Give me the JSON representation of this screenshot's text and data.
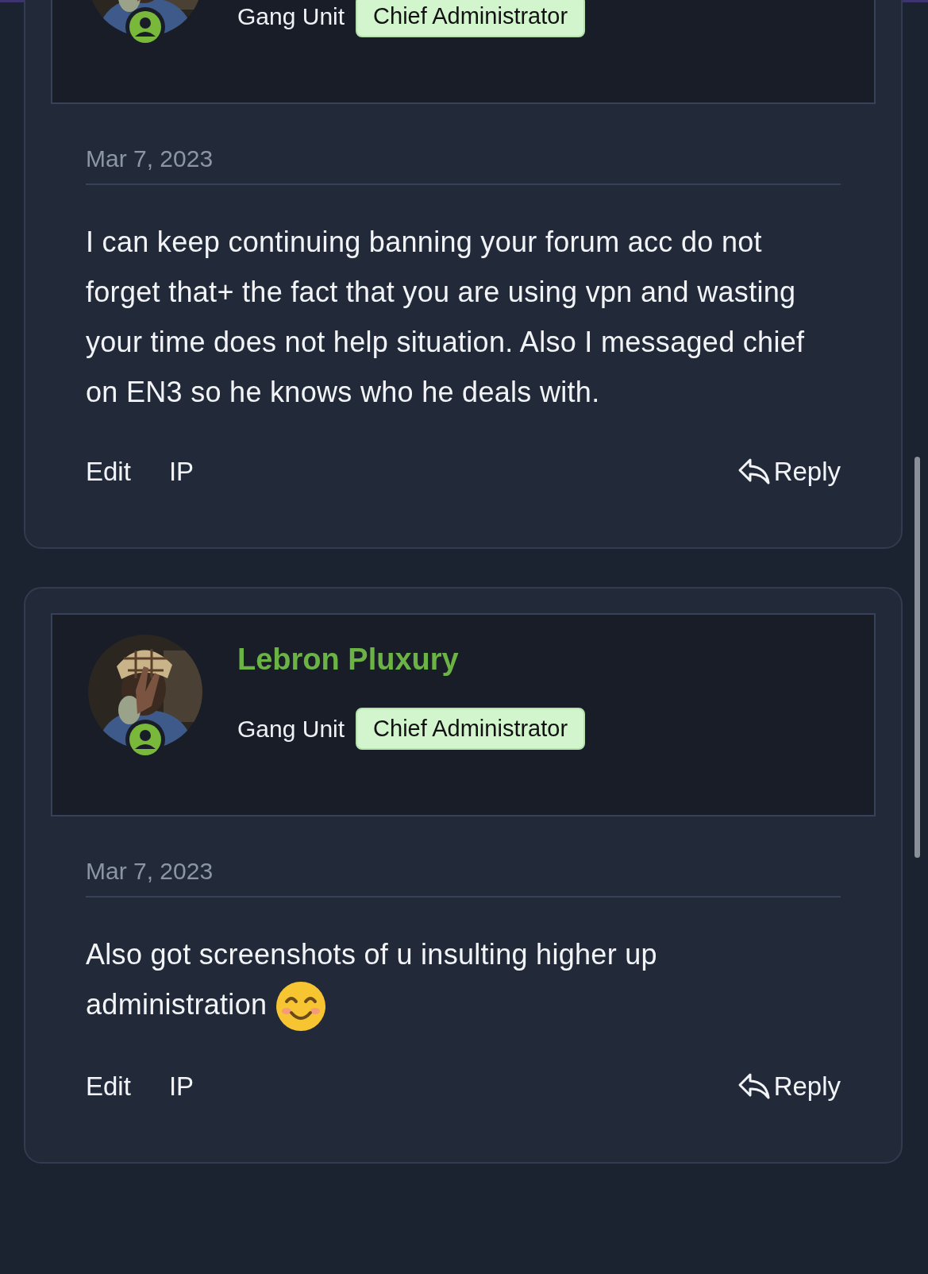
{
  "posts": [
    {
      "author": {
        "role": "Gang Unit",
        "badge": "Chief Administrator",
        "online": true
      },
      "date": "Mar 7, 2023",
      "body": [
        {
          "kind": "text",
          "text": "I can keep continuing banning your forum acc do not forget that+ the fact that you are using vpn and wasting your time does not help situation. Also I messaged chief on EN3 so he knows who he deals with."
        }
      ],
      "actions": [
        "Edit",
        "IP"
      ],
      "reply": "Reply"
    },
    {
      "author": {
        "name": "Lebron Pluxury",
        "role": "Gang Unit",
        "badge": "Chief Administrator",
        "online": true
      },
      "date": "Mar 7, 2023",
      "body": [
        {
          "kind": "text",
          "text": "Also got screenshots of u insulting higher up administration "
        },
        {
          "kind": "emoji"
        }
      ],
      "actions": [
        "Edit",
        "IP"
      ],
      "reply": "Reply"
    }
  ]
}
